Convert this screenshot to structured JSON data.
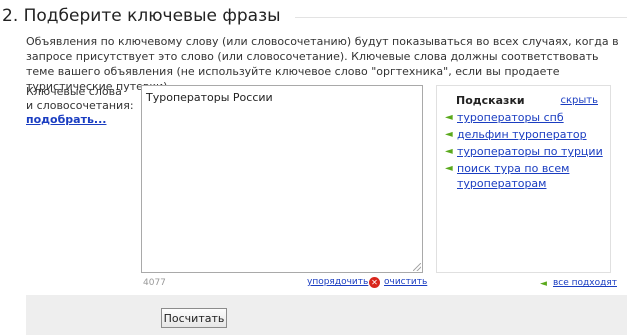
{
  "section": {
    "title": "2. Подберите ключевые фразы"
  },
  "description": "Объявления по ключевому слову (или словосочетанию) будут показываться во всех случаях, когда в запросе присутствует это слово (или словосочетание). Ключевые слова должны соответствовать теме вашего объявления (не используйте ключевое слово \"оргтехника\", если вы продаете туристические путевки).",
  "keywords": {
    "label_line1": "Ключевые слова",
    "label_line2": "и словосочетания:",
    "pick_link": "подобрать...",
    "value": "Туроператоры России",
    "counter": "4077",
    "order_link": "упорядочить",
    "clear_link": "очистить"
  },
  "hints": {
    "title": "Подсказки",
    "hide_link": "скрыть",
    "items": [
      "туроператоры спб",
      "дельфин туроператор",
      "туроператоры по турции",
      "поиск тура по всем туроператорам"
    ],
    "all_fits_link": "все подходят"
  },
  "actions": {
    "calculate_label": "Посчитать"
  },
  "icons": {
    "hint_arrow": "arrow-left-icon",
    "clear": "clear-icon"
  },
  "colors": {
    "link": "#1a3dc1",
    "arrow": "#5aa91c",
    "clear_icon": "#d9261c",
    "bottom_bar": "#eeeeee"
  }
}
